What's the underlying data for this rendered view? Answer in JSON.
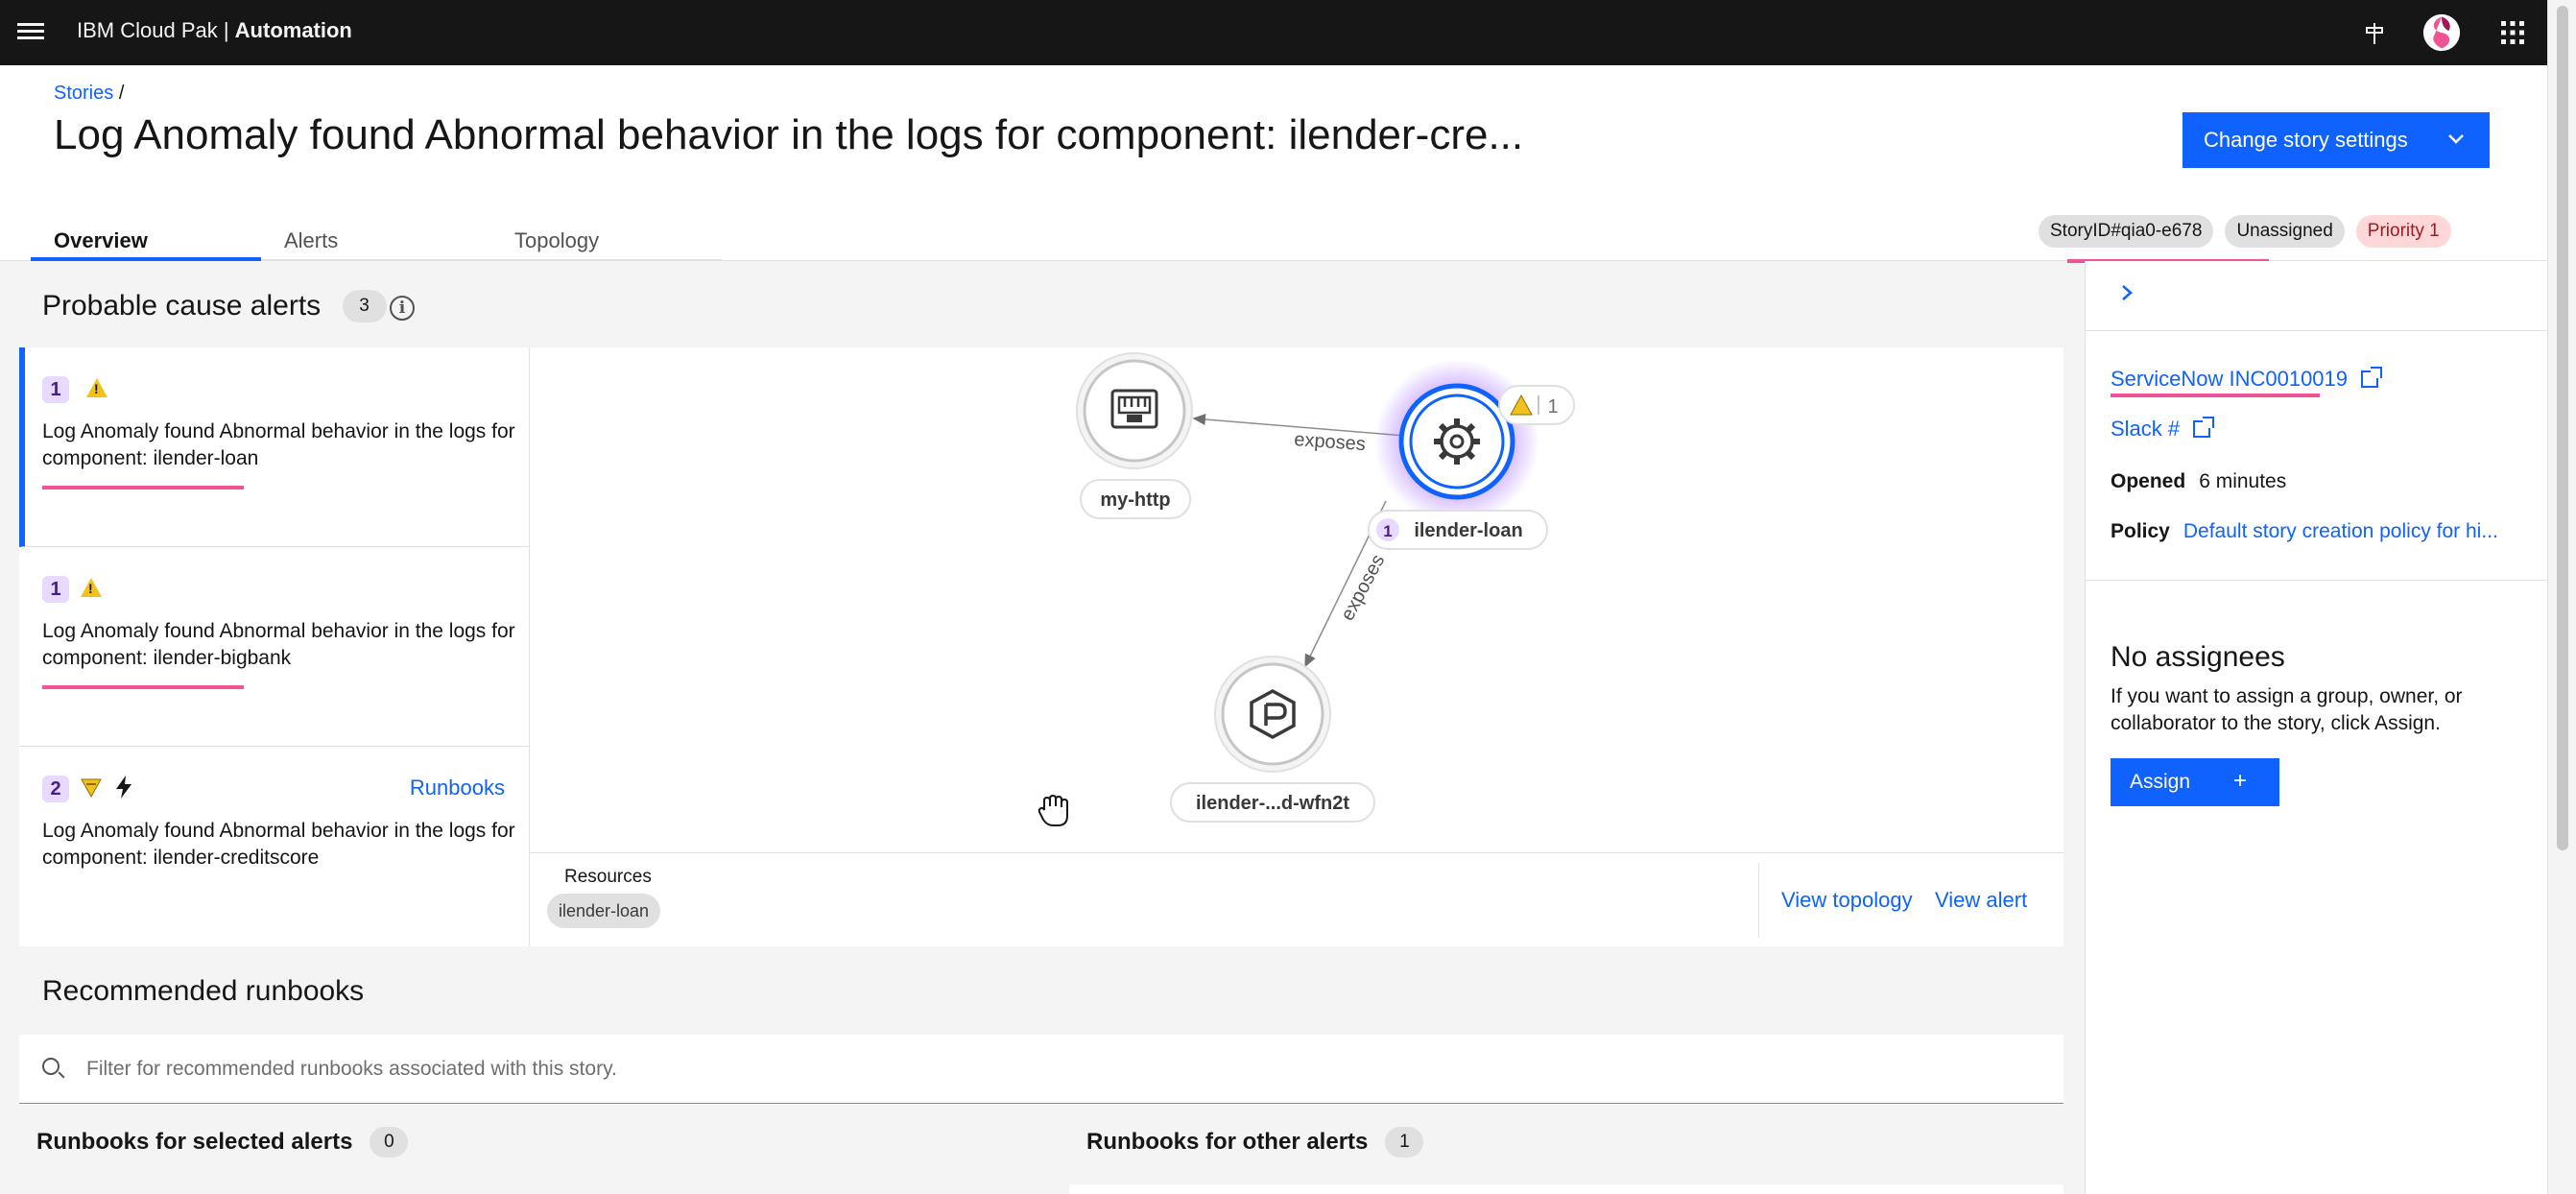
{
  "topbar": {
    "brand_prefix": "IBM Cloud Pak | ",
    "brand_product": "Automation"
  },
  "header": {
    "breadcrumb": "Stories",
    "breadcrumb_sep": "/",
    "title": "Log Anomaly found Abnormal behavior in the logs for component: ilender-cre...",
    "change_settings_label": "Change story settings",
    "tabs": [
      {
        "label": "Overview",
        "active": true
      },
      {
        "label": "Alerts",
        "active": false
      },
      {
        "label": "Topology",
        "active": false
      }
    ],
    "tags": [
      {
        "label": "StoryID#qia0-e678"
      },
      {
        "label": "Unassigned"
      },
      {
        "label": "Priority 1"
      }
    ]
  },
  "probable_cause": {
    "title": "Probable cause alerts",
    "count": "3",
    "alerts": [
      {
        "rank": "1",
        "text": "Log Anomaly found Abnormal behavior in the logs for component: ilender-loan",
        "severity": "warning-triangle-icon",
        "selected": true
      },
      {
        "rank": "1",
        "text": "Log Anomaly found Abnormal behavior in the logs for component: ilender-bigbank",
        "severity": "warning-triangle-icon",
        "selected": false
      },
      {
        "rank": "2",
        "text": "Log Anomaly found Abnormal behavior in the logs for component: ilender-creditscore",
        "severity": "minor-triangle-icon",
        "runbooks_label": "Runbooks",
        "selected": false
      }
    ]
  },
  "topology": {
    "nodes": [
      {
        "label": "my-http",
        "icon": "network-port-icon"
      },
      {
        "label": "ilender-loan",
        "icon": "gear-icon",
        "badge": "1",
        "alert_count": "1"
      },
      {
        "label": "ilender-...d-wfn2t",
        "icon": "pod-icon"
      }
    ],
    "edges": [
      {
        "label": "exposes"
      },
      {
        "label": "exposes"
      }
    ],
    "resources_label": "Resources",
    "resource_tag": "ilender-loan",
    "view_topology": "View topology",
    "view_alert": "View alert"
  },
  "side_panel": {
    "servicenow": "ServiceNow INC0010019",
    "slack": "Slack #",
    "opened_label": "Opened",
    "opened_value": "6 minutes",
    "policy_label": "Policy",
    "policy_value": "Default story creation policy for hi...",
    "no_assignees": "No assignees",
    "assign_desc": "If you want to assign a group, owner, or collaborator to the story, click Assign.",
    "assign_label": "Assign",
    "assign_plus": "+"
  },
  "runbooks": {
    "title": "Recommended runbooks",
    "filter_placeholder": "Filter for recommended runbooks associated with this story.",
    "selected_label": "Runbooks for selected alerts",
    "selected_count": "0",
    "other_label": "Runbooks for other alerts",
    "other_count": "1"
  },
  "colors": {
    "accent": "#0f62fe",
    "magenta": "#ee5396",
    "warning": "#f1c21b",
    "topbar": "#161616"
  }
}
